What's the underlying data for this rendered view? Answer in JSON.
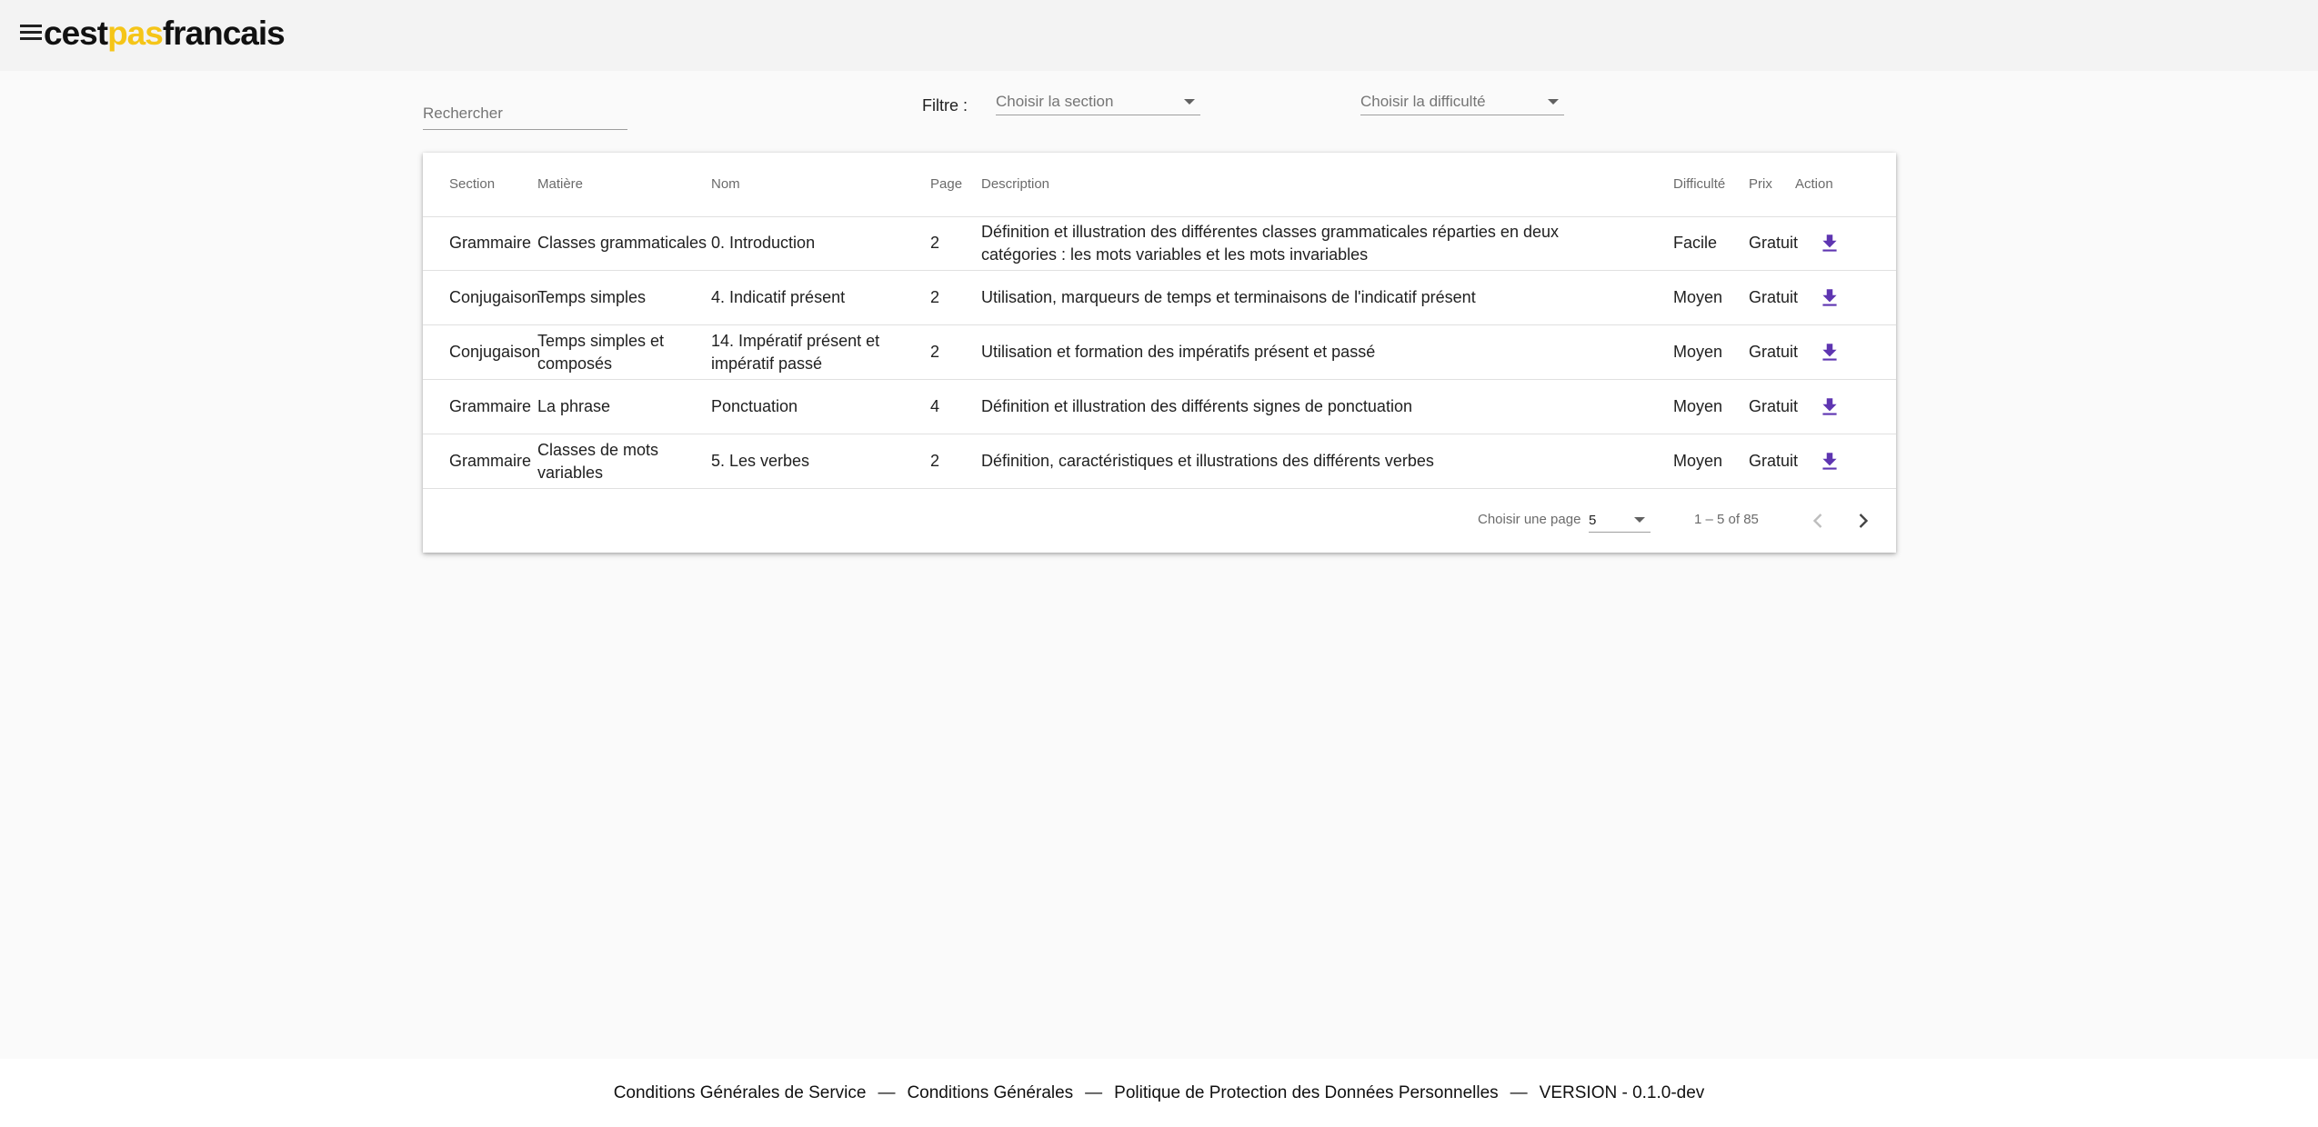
{
  "app": {
    "logo_prefix": "cest",
    "logo_accent": "pas",
    "logo_suffix": "francais",
    "accent_color": "#f5c518",
    "menu_icon": "hamburger-menu-icon"
  },
  "search": {
    "placeholder": "Rechercher"
  },
  "filter": {
    "label": "Filtre :",
    "section_placeholder": "Choisir la section",
    "difficulty_placeholder": "Choisir la difficulté"
  },
  "table": {
    "headers": {
      "section": "Section",
      "matiere": "Matière",
      "nom": "Nom",
      "page": "Page",
      "description": "Description",
      "difficulte": "Difficulté",
      "prix": "Prix",
      "action": "Action"
    },
    "action_icon": "download-icon",
    "action_color": "#5e35b1",
    "rows": [
      {
        "section": "Grammaire",
        "matiere": "Classes grammaticales",
        "nom": "0. Introduction",
        "page": "2",
        "description": "Définition et illustration des différentes classes grammaticales réparties en deux catégories : les mots variables et les mots invariables",
        "difficulte": "Facile",
        "prix": "Gratuit"
      },
      {
        "section": "Conjugaison",
        "matiere": "Temps simples",
        "nom": "4. Indicatif présent",
        "page": "2",
        "description": "Utilisation, marqueurs de temps et terminaisons de l'indicatif présent",
        "difficulte": "Moyen",
        "prix": "Gratuit"
      },
      {
        "section": "Conjugaison",
        "matiere": "Temps simples et composés",
        "nom": "14. Impératif présent et impératif passé",
        "page": "2",
        "description": "Utilisation et formation des impératifs présent et passé",
        "difficulte": "Moyen",
        "prix": "Gratuit"
      },
      {
        "section": "Grammaire",
        "matiere": "La phrase",
        "nom": "Ponctuation",
        "page": "4",
        "description": "Définition et illustration des différents signes de ponctuation",
        "difficulte": "Moyen",
        "prix": "Gratuit"
      },
      {
        "section": "Grammaire",
        "matiere": "Classes de mots variables",
        "nom": "5. Les verbes",
        "page": "2",
        "description": "Définition, caractéristiques et illustrations des différents verbes",
        "difficulte": "Moyen",
        "prix": "Gratuit"
      }
    ]
  },
  "paginator": {
    "page_size_label": "Choisir une page",
    "page_size": "5",
    "range": "1 – 5 of 85",
    "prev_icon": "chevron-left-icon",
    "next_icon": "chevron-right-icon"
  },
  "footer": {
    "links": [
      "Conditions Générales de Service",
      "Conditions Générales",
      "Politique de Protection des Données Personnelles"
    ],
    "separator": "—",
    "version": "VERSION - 0.1.0-dev"
  }
}
